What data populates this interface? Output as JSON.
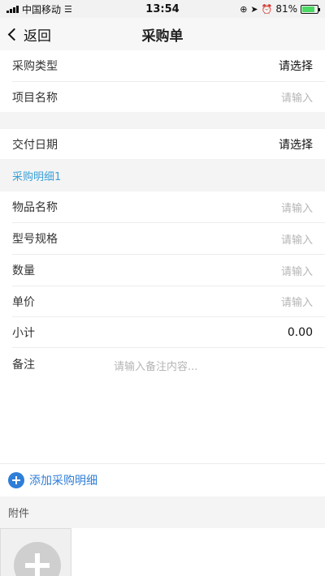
{
  "status": {
    "carrier": "中国移动",
    "time": "13:54",
    "battery": "81%"
  },
  "nav": {
    "back_label": "返回",
    "title": "采购单"
  },
  "form": {
    "purchase_type": {
      "label": "采购类型",
      "value": "请选择"
    },
    "project_name": {
      "label": "项目名称",
      "placeholder": "请输入"
    },
    "delivery_date": {
      "label": "交付日期",
      "value": "请选择"
    }
  },
  "detail": {
    "section_title": "采购明细1",
    "item_name": {
      "label": "物品名称",
      "placeholder": "请输入"
    },
    "model_spec": {
      "label": "型号规格",
      "placeholder": "请输入"
    },
    "quantity": {
      "label": "数量",
      "placeholder": "请输入"
    },
    "unit_price": {
      "label": "单价",
      "placeholder": "请输入"
    },
    "subtotal": {
      "label": "小计",
      "value": "0.00"
    },
    "remark": {
      "label": "备注",
      "placeholder": "请输入备注内容..."
    }
  },
  "add_detail_label": "添加采购明细",
  "attachment": {
    "label": "附件"
  },
  "colors": {
    "accent": "#2f7ed8",
    "section": "#3aa0d8",
    "battery": "#4cd964"
  }
}
